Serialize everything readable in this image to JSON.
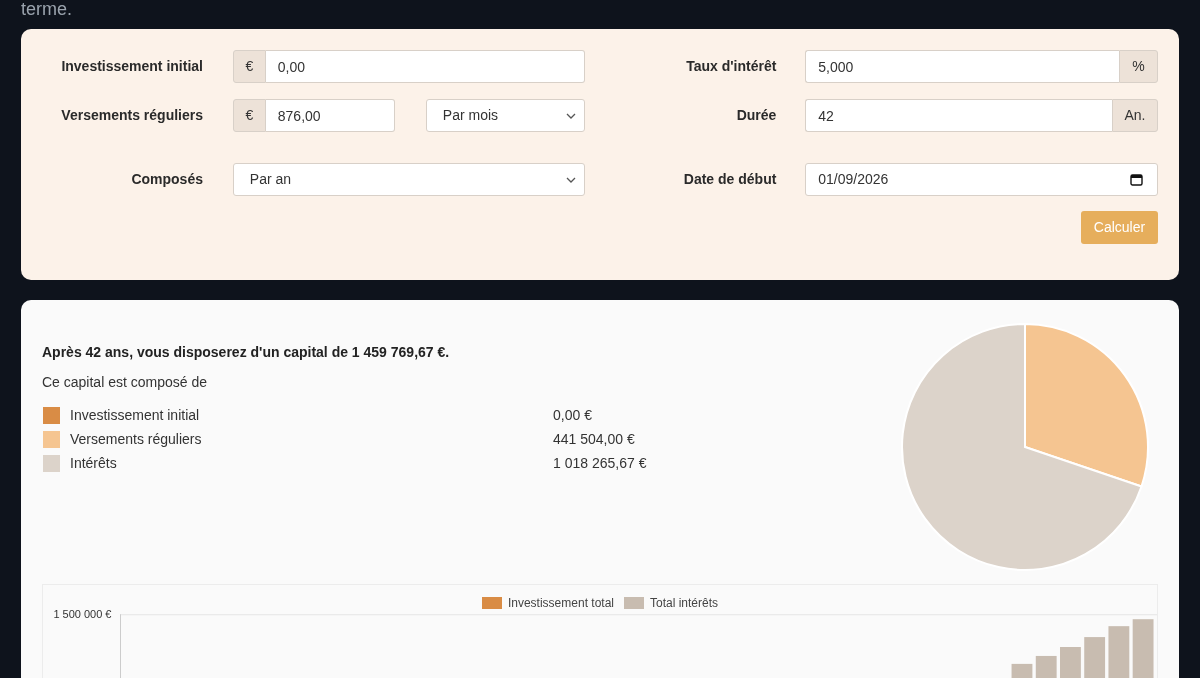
{
  "intro_tail": "terme.",
  "form": {
    "rows": [
      {
        "left": {
          "label": "Investissement initial",
          "kind": "prefixed",
          "addon": "€",
          "value": "0,00"
        },
        "right": {
          "label": "Taux d'intérêt",
          "kind": "suffixed",
          "addon": "%",
          "value": "5,000"
        }
      },
      {
        "left": {
          "label": "Versements réguliers",
          "kind": "prefixed_select",
          "addon": "€",
          "value": "876,00",
          "select": "Par mois"
        },
        "right": {
          "label": "Durée",
          "kind": "suffixed",
          "addon": "An.",
          "value": "42"
        }
      },
      {
        "left": {
          "label": "Composés",
          "kind": "select",
          "select": "Par an"
        },
        "right": {
          "label": "Date de début",
          "kind": "date",
          "value": "01/09/2026"
        }
      }
    ],
    "button": "Calculer"
  },
  "result": {
    "summary": "Après 42 ans, vous disposerez d'un capital de 1 459 769,67 €.",
    "intro": "Ce capital est composé de",
    "breakdown": [
      {
        "label": "Investissement initial",
        "value": "0,00 €",
        "color": "#d98c45"
      },
      {
        "label": "Versements réguliers",
        "value": "441 504,00 €",
        "color": "#f5c591"
      },
      {
        "label": "Intérêts",
        "value": "1 018 265,67 €",
        "color": "#dcd3ca"
      }
    ],
    "chart_data": {
      "type": "pie",
      "values": [
        0,
        30.2,
        69.8
      ]
    }
  },
  "growth_chart": {
    "legend": [
      {
        "label": "Investissement total",
        "color": "#d98c45"
      },
      {
        "label": "Total intérêts",
        "color": "#c8bcb0"
      }
    ],
    "y_tick": "1 500 000 €"
  }
}
